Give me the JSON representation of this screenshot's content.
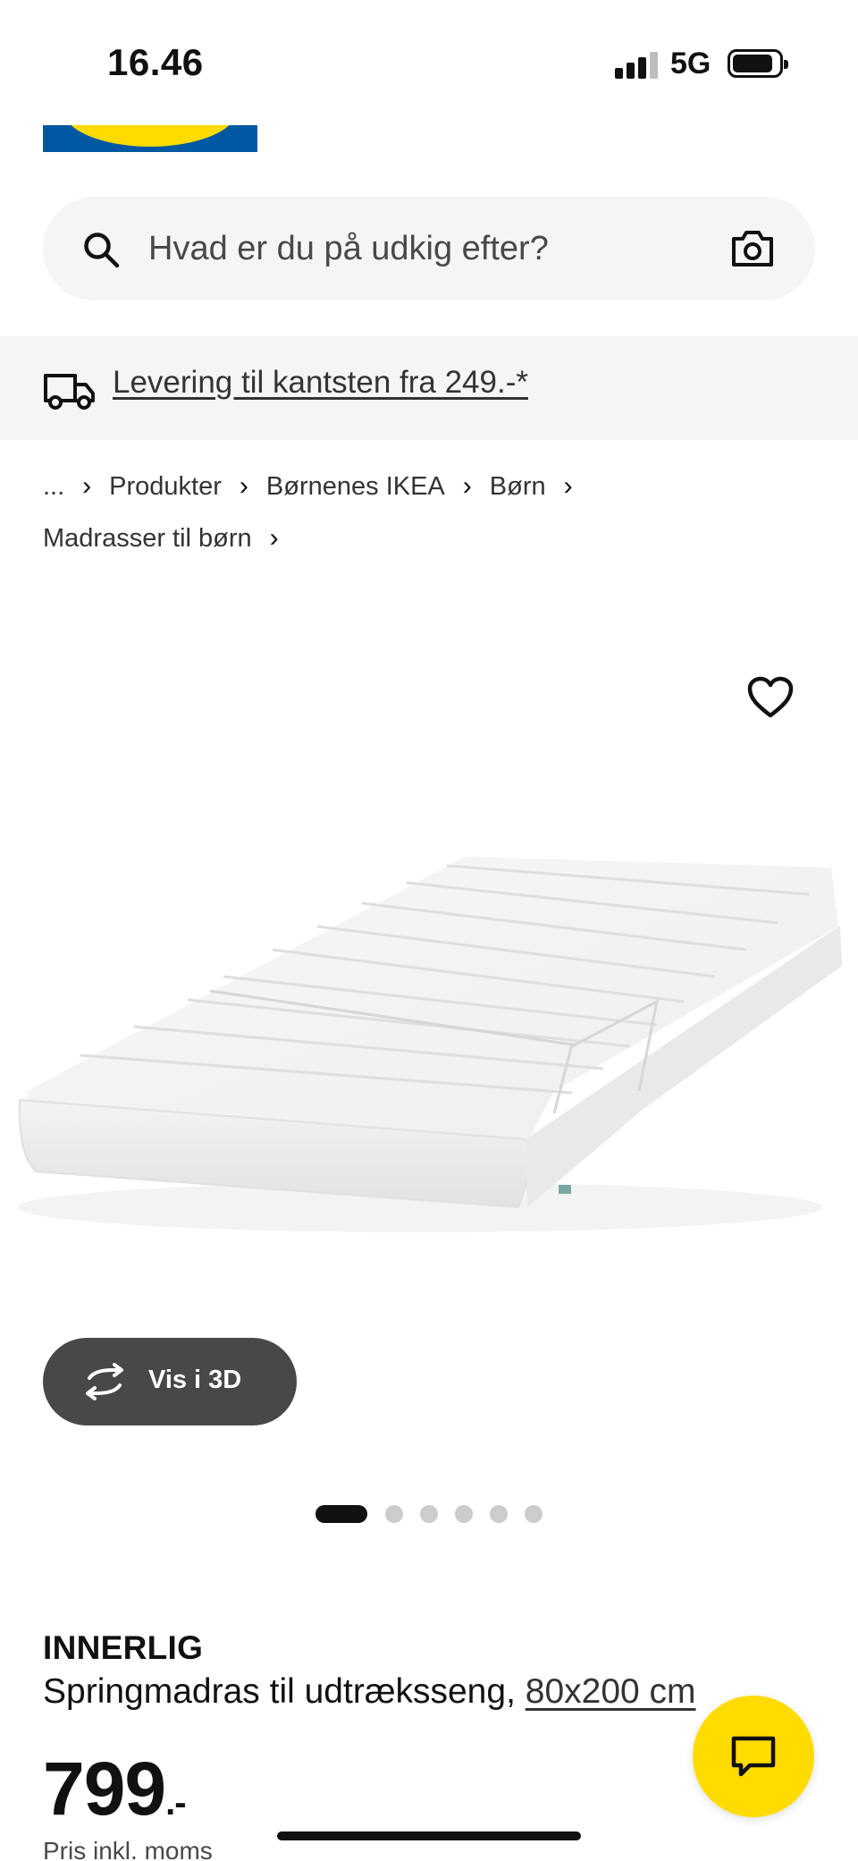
{
  "status_bar": {
    "time": "16.46",
    "network": "5G"
  },
  "brand": {
    "logo_colors": {
      "blue": "#0058a3",
      "yellow": "#ffdb00"
    }
  },
  "search": {
    "placeholder": "Hvad er du på udkig efter?",
    "icon": "search-icon",
    "camera_icon": "camera-icon"
  },
  "delivery": {
    "icon": "truck-icon",
    "link_text": "Levering til kantsten fra 249.-*"
  },
  "breadcrumb": {
    "items": [
      "...",
      "Produkter",
      "Børnenes IKEA",
      "Børn",
      "Madrasser til børn"
    ]
  },
  "gallery": {
    "wishlist_icon": "heart-icon",
    "view_3d_label": "Vis i 3D",
    "slide_count": 6,
    "active_slide": 1
  },
  "product": {
    "name": "INNERLIG",
    "description": "Springmadras til udtræksseng,",
    "size": "80x200 cm",
    "price": "799",
    "price_suffix": ".-",
    "price_note": "Pris inkl. moms"
  },
  "chat": {
    "icon": "chat-icon",
    "color": "#ffdb00"
  }
}
